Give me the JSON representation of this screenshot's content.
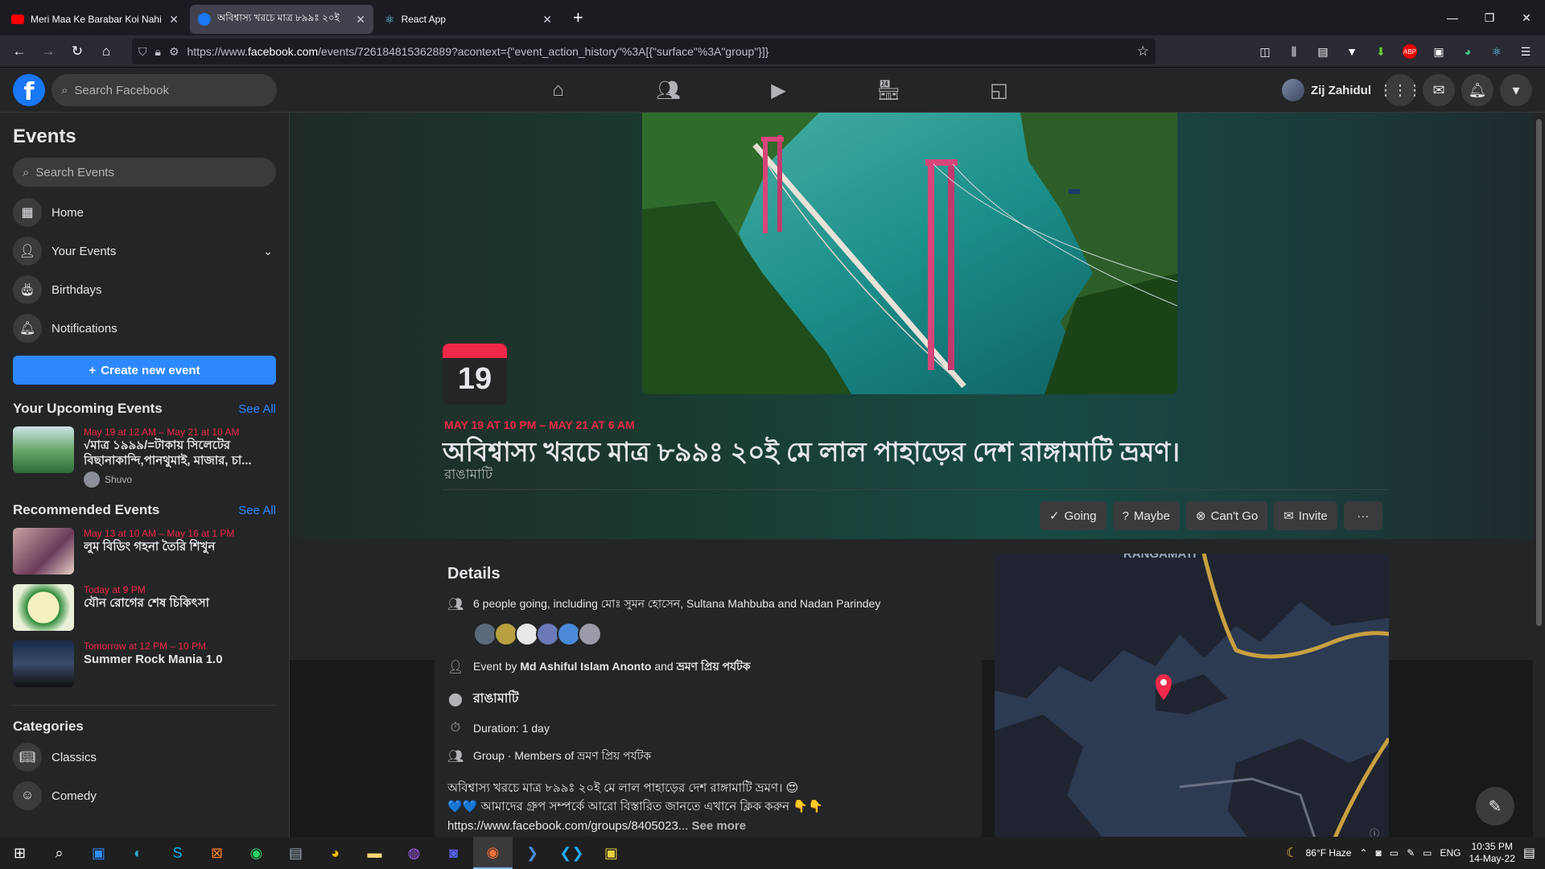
{
  "browser": {
    "tabs": [
      {
        "title": "Meri Maa Ke Barabar Koi Nahi (",
        "icon": "youtube-icon"
      },
      {
        "title": "অবিশ্বাস্য খরচে মাত্র ৮৯৯ঃ ২০ই",
        "icon": "facebook-icon"
      },
      {
        "title": "React App",
        "icon": "react-icon"
      }
    ],
    "url_prefix": "https://www.",
    "url_domain": "facebook.com",
    "url_rest": "/events/726184815362889?acontext={\"event_action_history\"%3A[{\"surface\"%3A\"group\"}]}"
  },
  "fb": {
    "search_placeholder": "Search Facebook",
    "profile_name": "Zij Zahidul"
  },
  "sidebar": {
    "title": "Events",
    "search_placeholder": "Search Events",
    "nav": [
      {
        "label": "Home",
        "icon": "calendar-grid-icon"
      },
      {
        "label": "Your Events",
        "icon": "person-icon"
      },
      {
        "label": "Birthdays",
        "icon": "cake-icon"
      },
      {
        "label": "Notifications",
        "icon": "bell-icon"
      }
    ],
    "create_label": "Create new event",
    "upcoming_title": "Your Upcoming Events",
    "see_all": "See All",
    "upcoming": [
      {
        "date": "May 19 at 12 AM – May 21 at 10 AM",
        "name": "√মাত্র ১৯৯৯/=টাকায় সিলেটের বিছানাকান্দি,পানথুমাই, মাজার, চা...",
        "host": "Shuvo"
      }
    ],
    "recommended_title": "Recommended Events",
    "recommended": [
      {
        "date": "May 13 at 10 AM – May 16 at 1 PM",
        "name": "লুম বিডিং গহনা তৈরি শিখুন"
      },
      {
        "date": "Today at 9 PM",
        "name": "যৌন রোগের শেষ চিকিৎসা"
      },
      {
        "date": "Tomorrow at 12 PM – 10 PM",
        "name": "Summer Rock Mania 1.0"
      }
    ],
    "categories_title": "Categories",
    "categories": [
      {
        "label": "Classics"
      },
      {
        "label": "Comedy"
      }
    ]
  },
  "event": {
    "day": "19",
    "date_range": "MAY 19 AT 10 PM – MAY 21 AT 6 AM",
    "title": "অবিশ্বাস্য খরচে মাত্র ৮৯৯ঃ ২০ই মে লাল পাহাড়ের দেশ রাঙ্গামাটি ভ্রমণ।",
    "location": "রাঙামাটি",
    "actions": {
      "going": "Going",
      "maybe": "Maybe",
      "cant_go": "Can't Go",
      "invite": "Invite",
      "more": "···"
    },
    "details_title": "Details",
    "going_prefix": "6 people going, including ",
    "going_names": "মোঃ সুমন হোসেন",
    "going_rest": ", Sultana Mahbuba and Nadan Parindey",
    "event_by_prefix": "Event by ",
    "event_by_host": "Md Ashiful Islam Anonto",
    "event_by_and": " and ",
    "event_by_page": "ভ্রমণ প্রিয় পর্যটক",
    "place": "রাঙামাটি",
    "duration": "Duration: 1 day",
    "group_prefix": "Group · Members of ",
    "group_name": "ভ্রমণ প্রিয় পর্যটক",
    "desc_line1": "অবিশ্বাস্য খরচে মাত্র ৮৯৯ঃ ২০ই মে লাল পাহাড়ের দেশ রাঙ্গামাটি ভ্রমণ। 😍",
    "desc_line2": "💙💙 আমাদের গ্রুপ সম্পর্কে আরো বিস্তারিত জানতে এখানে ক্লিক করুন 👇👇",
    "desc_link": "https://www.facebook.com/groups/8405023...",
    "see_more": "See more",
    "map_label": "RANGAMATI"
  },
  "taskbar": {
    "weather": "86°F  Haze",
    "lang": "ENG",
    "time": "10:35 PM",
    "date": "14-May-22"
  }
}
